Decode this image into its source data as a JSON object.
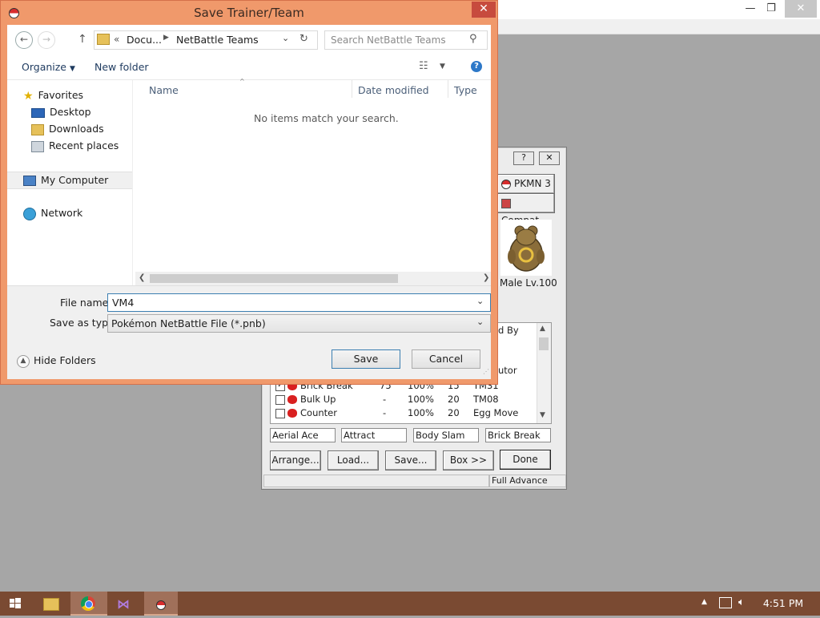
{
  "dialog": {
    "title": "Save Trainer/Team",
    "close_glyph": "✕",
    "breadcrumb_prefix": "«",
    "breadcrumb": [
      "Docu...",
      "NetBattle Teams"
    ],
    "search_placeholder": "Search NetBattle Teams",
    "toolbar": {
      "organize": "Organize",
      "new_folder": "New folder"
    },
    "columns": [
      "Name",
      "Date modified",
      "Type"
    ],
    "empty_message": "No items match your search.",
    "nav": {
      "favorites": "Favorites",
      "favorites_items": [
        "Desktop",
        "Downloads",
        "Recent places"
      ],
      "my_computer": "My Computer",
      "network": "Network"
    },
    "file_name_label": "File name:",
    "file_name_value": "VM4",
    "save_type_label": "Save as type:",
    "save_type_value": "Pokémon NetBattle File (*.pnb)",
    "hide_folders": "Hide Folders",
    "save_button": "Save",
    "cancel_button": "Cancel"
  },
  "netbattle": {
    "help_glyph": "?",
    "close_glyph": "✕",
    "pkmn_button": "PKMN 3",
    "compat_button": "Compat.",
    "pokemon_info": "Male Lv.100",
    "learned_by_header": "d By",
    "tutor_fragment": "utor",
    "moves": [
      {
        "name": "Brick Break",
        "power": "75",
        "accuracy": "100%",
        "pp": "15",
        "learned_by": "TM31",
        "checked": true
      },
      {
        "name": "Bulk Up",
        "power": "-",
        "accuracy": "100%",
        "pp": "20",
        "learned_by": "TM08",
        "checked": false
      },
      {
        "name": "Counter",
        "power": "-",
        "accuracy": "100%",
        "pp": "20",
        "learned_by": "Egg Move",
        "checked": false
      }
    ],
    "selected_moves": [
      "Aerial Ace",
      "Attract",
      "Body Slam",
      "Brick Break"
    ],
    "buttons": [
      "Arrange...",
      "Load...",
      "Save...",
      "Box >>",
      "Done"
    ],
    "status": "Full Advance"
  },
  "background_window": {
    "minimize": "—",
    "restore": "❐",
    "close": "✕"
  },
  "taskbar": {
    "clock": "4:51 PM"
  }
}
